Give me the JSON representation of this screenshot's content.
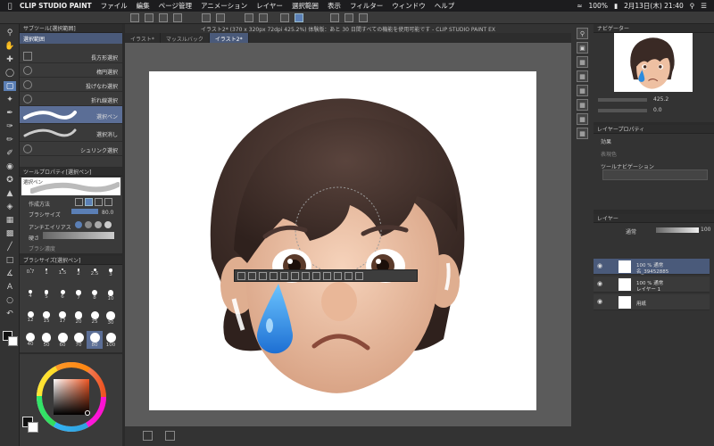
{
  "menubar": {
    "app_name": "CLIP STUDIO PAINT",
    "items": [
      "ファイル",
      "編集",
      "ページ管理",
      "アニメーション",
      "レイヤー",
      "選択範囲",
      "表示",
      "フィルター",
      "ウィンドウ",
      "ヘルプ"
    ],
    "battery": "100%",
    "clock": "2月13日(木) 21:40"
  },
  "document": {
    "title": "イラスト2* (370 x 320px 72dpi 425.2%) 体験版：あと 30 日間すべての機能を使用可能です - CLIP STUDIO PAINT EX",
    "tabs": [
      "イラスト*",
      "マッスルバック",
      "イラスト2*"
    ]
  },
  "subtool": {
    "header": "サブツール[選択範囲]",
    "tab": "選択範囲",
    "items": [
      "長方形選択",
      "楕円選択",
      "投げなわ選択",
      "折れ線選択",
      "選択ペン",
      "選択消し",
      "シュリンク選択"
    ]
  },
  "tool_property": {
    "header": "ツールプロパティ[選択ペン]",
    "preview_label": "選択ペン",
    "creation_method": "作成方法",
    "brush_size_label": "ブラシサイズ",
    "brush_size_value": "80.0",
    "antialias_label": "アンチエイリアス",
    "hardness_label": "硬さ",
    "brush_density_label": "ブラシ濃度"
  },
  "brush_size_panel": {
    "header": "ブラシサイズ[選択ペン]",
    "sizes": [
      "0.7",
      "1",
      "1.5",
      "2",
      "2.5",
      "3",
      "4",
      "5",
      "6",
      "7",
      "8",
      "10",
      "12",
      "15",
      "17",
      "20",
      "25",
      "30",
      "40",
      "50",
      "60",
      "70",
      "80",
      "100"
    ],
    "selected": "80"
  },
  "navigator": {
    "header": "ナビゲーター",
    "zoom": "425.2",
    "rotation": "0.0"
  },
  "layer_property": {
    "header": "レイヤープロパティ",
    "effect_label": "効果",
    "expression_color": "表現色",
    "tool_navigation": "ツールナビゲーション"
  },
  "layers": {
    "header": "レイヤー",
    "blend_mode": "通常",
    "opacity": "100",
    "rows": [
      {
        "line1": "100 % 通常",
        "line2": "名_39452885"
      },
      {
        "line1": "100 % 通常",
        "line2": "レイヤー 1"
      },
      {
        "line1": "用紙",
        "line2": ""
      }
    ]
  },
  "colors": {
    "accent": "#5b7fb5",
    "panel": "#3a3a3a",
    "canvas_bg": "#5b5b5b",
    "hair": "#3d2b26",
    "skin": "#efc6aa",
    "tear": "#2b8bde"
  }
}
